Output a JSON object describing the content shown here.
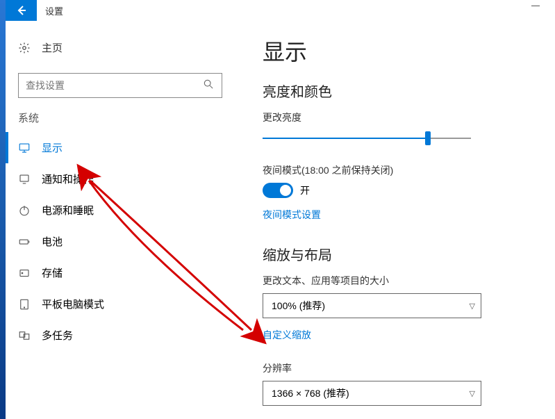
{
  "titlebar": {
    "title": "设置"
  },
  "sidebar": {
    "home": "主页",
    "search_placeholder": "查找设置",
    "section": "系统",
    "items": [
      {
        "label": "显示",
        "key": "display"
      },
      {
        "label": "通知和操作",
        "key": "notifications"
      },
      {
        "label": "电源和睡眠",
        "key": "power"
      },
      {
        "label": "电池",
        "key": "battery"
      },
      {
        "label": "存储",
        "key": "storage"
      },
      {
        "label": "平板电脑模式",
        "key": "tablet"
      },
      {
        "label": "多任务",
        "key": "multitask"
      }
    ]
  },
  "content": {
    "page_title": "显示",
    "brightness_heading": "亮度和颜色",
    "brightness_label": "更改亮度",
    "brightness_value": 78,
    "nightlight_label": "夜间模式(18:00 之前保持关闭)",
    "nightlight_on": "开",
    "nightlight_settings": "夜间模式设置",
    "scale_heading": "缩放与布局",
    "scale_label": "更改文本、应用等项目的大小",
    "scale_value": "100% (推荐)",
    "custom_scale": "自定义缩放",
    "resolution_label": "分辨率",
    "resolution_value": "1366 × 768 (推荐)"
  },
  "annotations": {
    "arrow_color": "#d40000"
  }
}
